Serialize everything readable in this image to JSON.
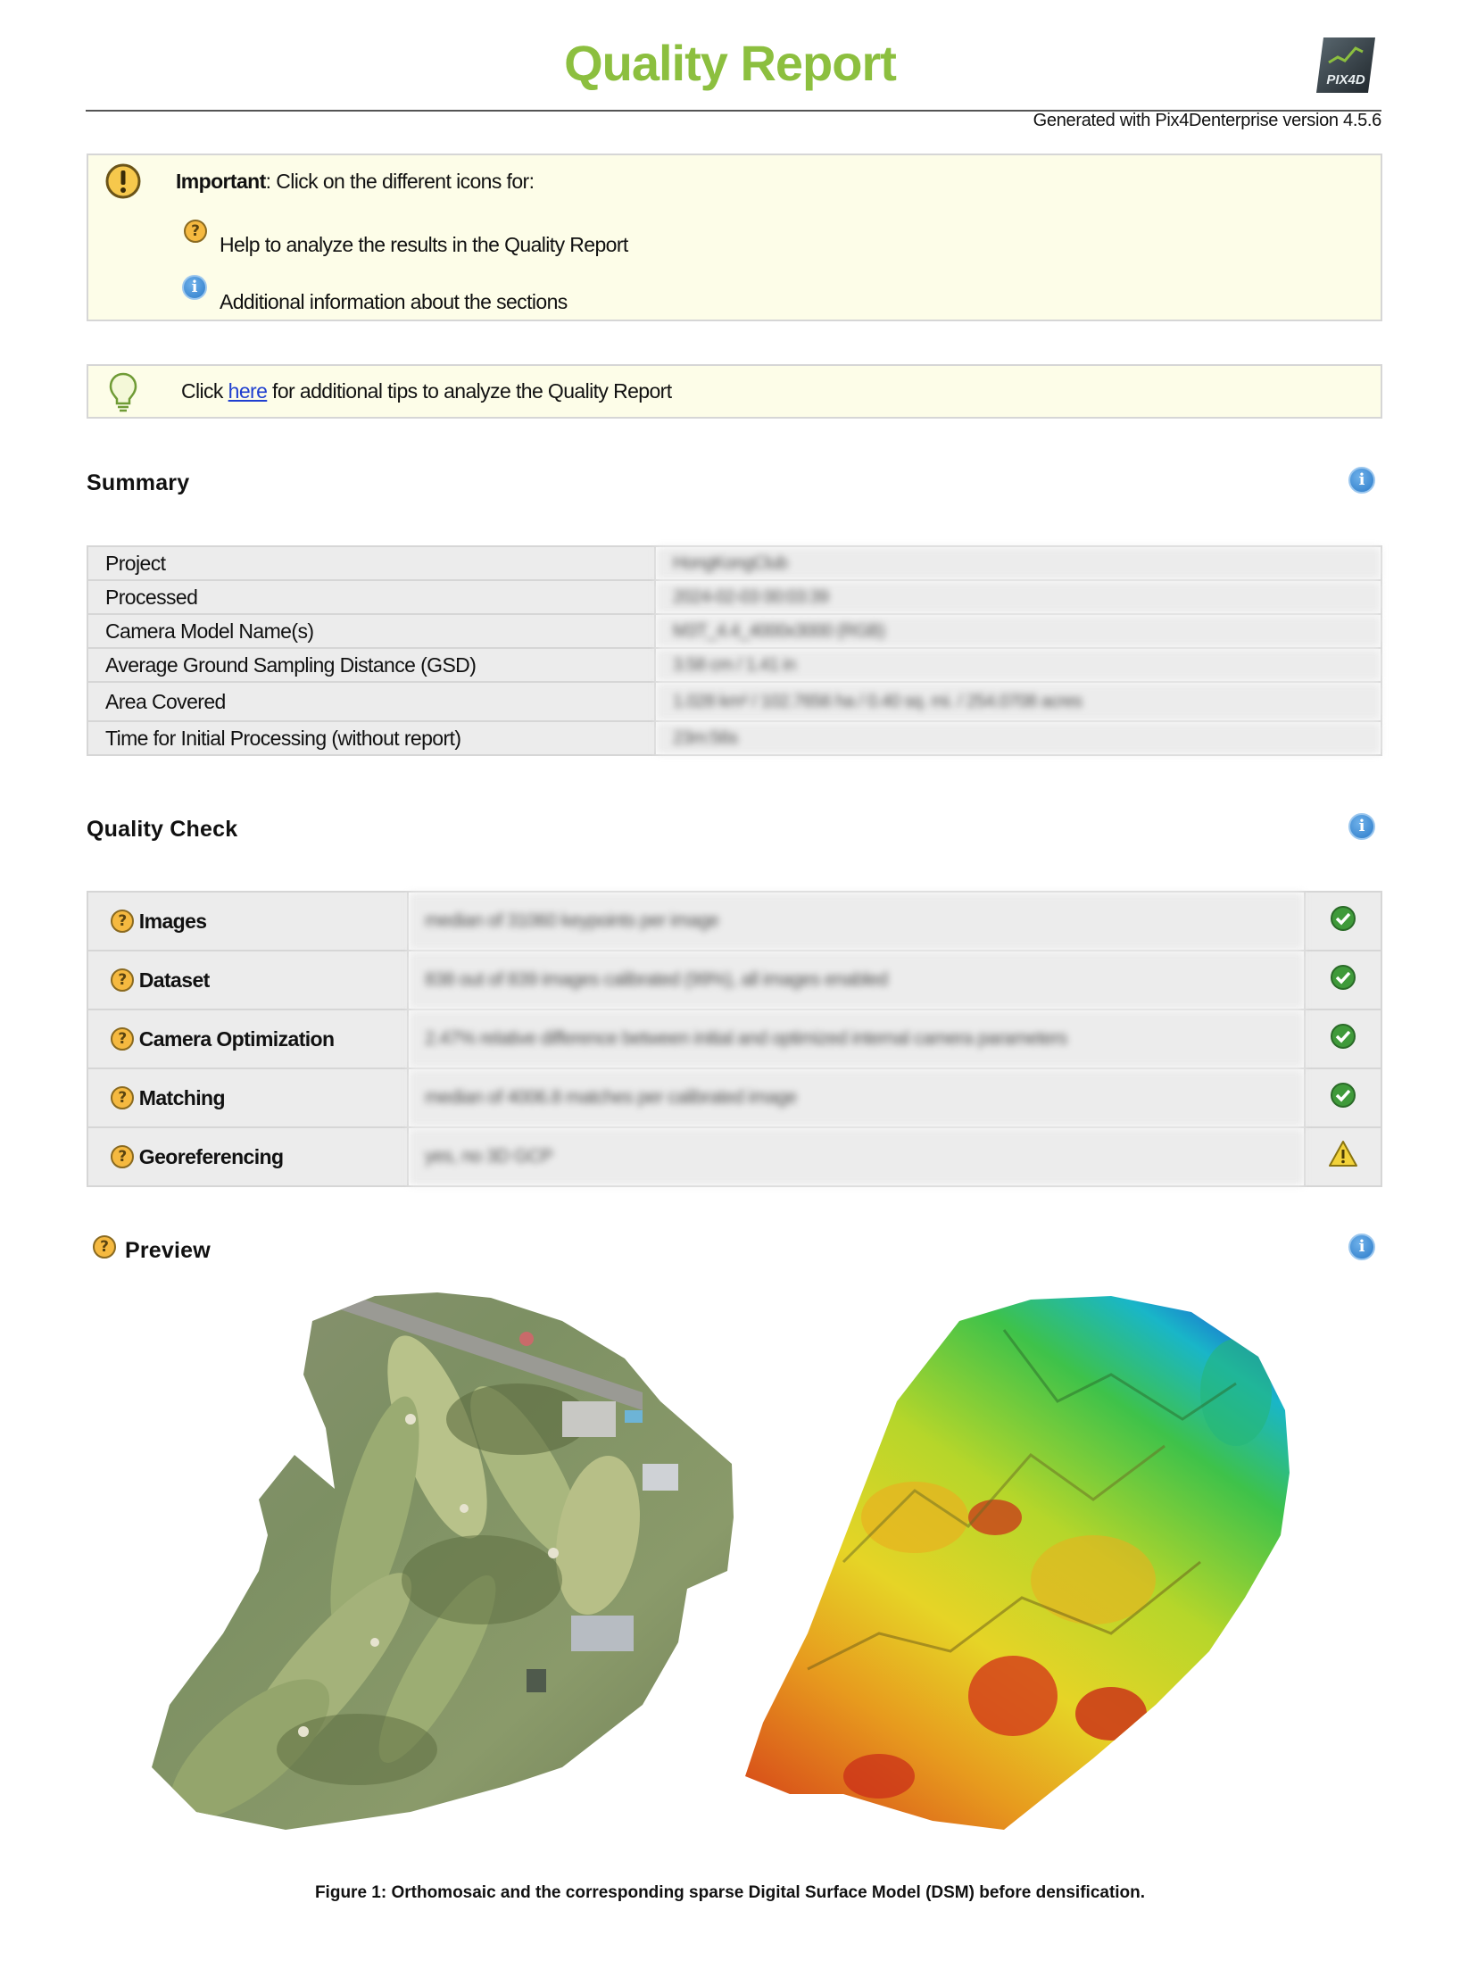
{
  "header": {
    "title": "Quality Report",
    "generated": "Generated with Pix4Denterprise version 4.5.6",
    "logo_text": "PIX4D"
  },
  "important_box": {
    "label_bold": "Important",
    "label_rest": ": Click on the different icons for:",
    "line1": "Help to analyze the results in the Quality Report",
    "line2": "Additional information about the sections"
  },
  "tip_box": {
    "prefix": "Click ",
    "link": "here",
    "suffix": " for additional tips to analyze the Quality Report"
  },
  "summary": {
    "title": "Summary",
    "rows": [
      {
        "label": "Project",
        "value": "HongKongClub"
      },
      {
        "label": "Processed",
        "value": "2024-02-03 00:03:39"
      },
      {
        "label": "Camera Model Name(s)",
        "value": "M3T_4.4_4000x3000 (RGB)"
      },
      {
        "label": "Average Ground Sampling Distance (GSD)",
        "value": "3.58 cm / 1.41 in"
      },
      {
        "label": "Area Covered",
        "value": "1.028 km² / 102.7656 ha / 0.40 sq. mi. / 254.0708 acres"
      },
      {
        "label": "Time for Initial Processing (without report)",
        "value": "23m:56s"
      }
    ]
  },
  "quality_check": {
    "title": "Quality Check",
    "rows": [
      {
        "label": "Images",
        "value": "median of 31060 keypoints per image",
        "status": "ok"
      },
      {
        "label": "Dataset",
        "value": "838 out of 839 images calibrated (99%), all images enabled",
        "status": "ok"
      },
      {
        "label": "Camera Optimization",
        "value": "2.47% relative difference between initial and optimized internal camera parameters",
        "status": "ok"
      },
      {
        "label": "Matching",
        "value": "median of 4006.8 matches per calibrated image",
        "status": "ok"
      },
      {
        "label": "Georeferencing",
        "value": "yes, no 3D GCP",
        "status": "warning"
      }
    ]
  },
  "preview": {
    "title": "Preview",
    "caption": "Figure 1: Orthomosaic and the corresponding sparse Digital Surface Model (DSM) before densification."
  },
  "colors": {
    "title_green": "#8cbf3f",
    "box_fill": "#fdfde8",
    "table_fill": "#ececec",
    "ok_green": "#3f9a3a",
    "warn_yellow": "#f2d23a",
    "info_blue": "#2c7bc9",
    "help_orange": "#f5b940"
  },
  "icons": [
    "warning-circle-icon",
    "help-icon",
    "info-icon",
    "lightbulb-icon",
    "check-icon",
    "warning-triangle-icon"
  ]
}
